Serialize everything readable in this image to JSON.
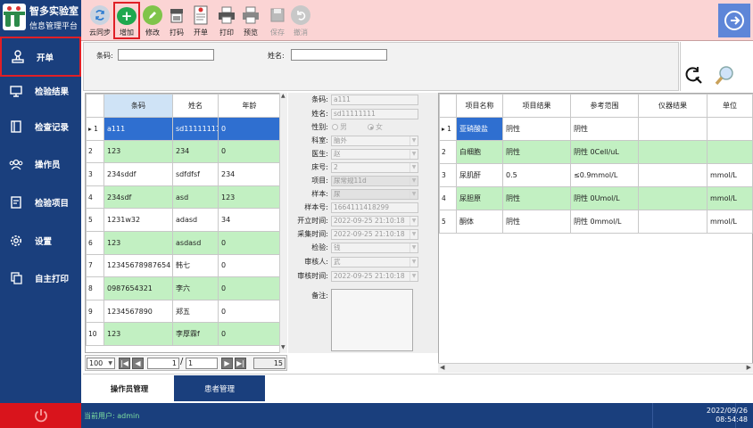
{
  "app": {
    "title_line1": "智多实验室",
    "title_line2": "信息管理平台"
  },
  "sidebar": {
    "items": [
      {
        "label": "开单",
        "icon": "stamp-icon"
      },
      {
        "label": "检验结果",
        "icon": "monitor-icon"
      },
      {
        "label": "检查记录",
        "icon": "notebook-icon"
      },
      {
        "label": "操作员",
        "icon": "users-icon"
      },
      {
        "label": "检验项目",
        "icon": "document-edit-icon"
      },
      {
        "label": "设置",
        "icon": "gear-icon"
      },
      {
        "label": "自主打印",
        "icon": "copy-icon"
      }
    ]
  },
  "toolbar": {
    "cloud_sync": "云同步",
    "add": "增加",
    "edit": "修改",
    "print_code": "打码",
    "open_order": "开单",
    "print": "打印",
    "preview": "预览",
    "save": "保存",
    "undo": "撤消"
  },
  "search": {
    "barcode_label": "条码:",
    "barcode_value": "",
    "name_label": "姓名:",
    "name_value": ""
  },
  "grid": {
    "headers": [
      "条码",
      "姓名",
      "年龄"
    ],
    "rows": [
      {
        "n": "1",
        "barcode": "a111",
        "name": "sd11111111",
        "age": "0"
      },
      {
        "n": "2",
        "barcode": "123",
        "name": "234",
        "age": "0"
      },
      {
        "n": "3",
        "barcode": "234sddf",
        "name": "sdfdfsf",
        "age": "234"
      },
      {
        "n": "4",
        "barcode": "234sdf",
        "name": "asd",
        "age": "123"
      },
      {
        "n": "5",
        "barcode": "1231w32",
        "name": "adasd",
        "age": "34"
      },
      {
        "n": "6",
        "barcode": "123",
        "name": "asdasd",
        "age": "0"
      },
      {
        "n": "7",
        "barcode": "12345678987654",
        "name": "韩七",
        "age": "0"
      },
      {
        "n": "8",
        "barcode": "0987654321",
        "name": "李六",
        "age": "0"
      },
      {
        "n": "9",
        "barcode": "1234567890",
        "name": "郑五",
        "age": "0"
      },
      {
        "n": "10",
        "barcode": "123",
        "name": "李厚霖f",
        "age": "0"
      }
    ]
  },
  "pager": {
    "page_size": "100",
    "current": "1",
    "separator": "/",
    "total_pages": "1",
    "total_records": "15"
  },
  "form": {
    "barcode_label": "条码:",
    "barcode": "a111",
    "name_label": "姓名:",
    "name": "sd11111111",
    "gender_label": "性别:",
    "male": "男",
    "female": "女",
    "dept_label": "科室:",
    "dept": "脑外",
    "doctor_label": "医生:",
    "doctor": "赵",
    "bed_label": "床号:",
    "bed": "2",
    "project_label": "项目:",
    "project": "尿常规11d",
    "sample_label": "样本:",
    "sample": "尿",
    "sample_no_label": "样本号:",
    "sample_no": "1664111418299",
    "open_time_label": "开立时间:",
    "open_time": "2022-09-25 21:10:18",
    "collect_time_label": "采集时间:",
    "collect_time": "2022-09-25 21:10:18",
    "inspector_label": "检验:",
    "inspector": "钱",
    "reviewer_label": "审核人:",
    "reviewer": "武",
    "review_time_label": "审核时间:",
    "review_time": "2022-09-25 21:10:18",
    "remark_label": "备注:"
  },
  "results": {
    "headers": [
      "项目名称",
      "项目结果",
      "参考范围",
      "仪器结果",
      "单位"
    ],
    "rows": [
      {
        "n": "1",
        "name": "亚硝酸盐",
        "result": "阴性",
        "range": "阴性",
        "instrument": "",
        "unit": ""
      },
      {
        "n": "2",
        "name": "白细胞",
        "result": "阴性",
        "range": "阴性 0Cell/uL",
        "instrument": "",
        "unit": ""
      },
      {
        "n": "3",
        "name": "尿肌酐",
        "result": "0.5",
        "range": "≤0.9mmol/L",
        "instrument": "",
        "unit": "mmol/L"
      },
      {
        "n": "4",
        "name": "尿胆原",
        "result": "阴性",
        "range": "阴性 0Umol/L",
        "instrument": "",
        "unit": "mmol/L"
      },
      {
        "n": "5",
        "name": "酮体",
        "result": "阴性",
        "range": "阴性 0mmol/L",
        "instrument": "",
        "unit": "mmol/L"
      }
    ]
  },
  "tabs": [
    {
      "label": "操作员管理"
    },
    {
      "label": "患者管理"
    }
  ],
  "status": {
    "user": "当前用户: admin",
    "date": "2022/09/26",
    "time": "08:54:48"
  },
  "colors": {
    "sidebar": "#1a3f7d",
    "toolbar": "#fbd4d4",
    "row_green": "#c2f0c2",
    "selection": "#2f6fd0",
    "highlight_border": "#e01f26",
    "power": "#d9141c"
  }
}
